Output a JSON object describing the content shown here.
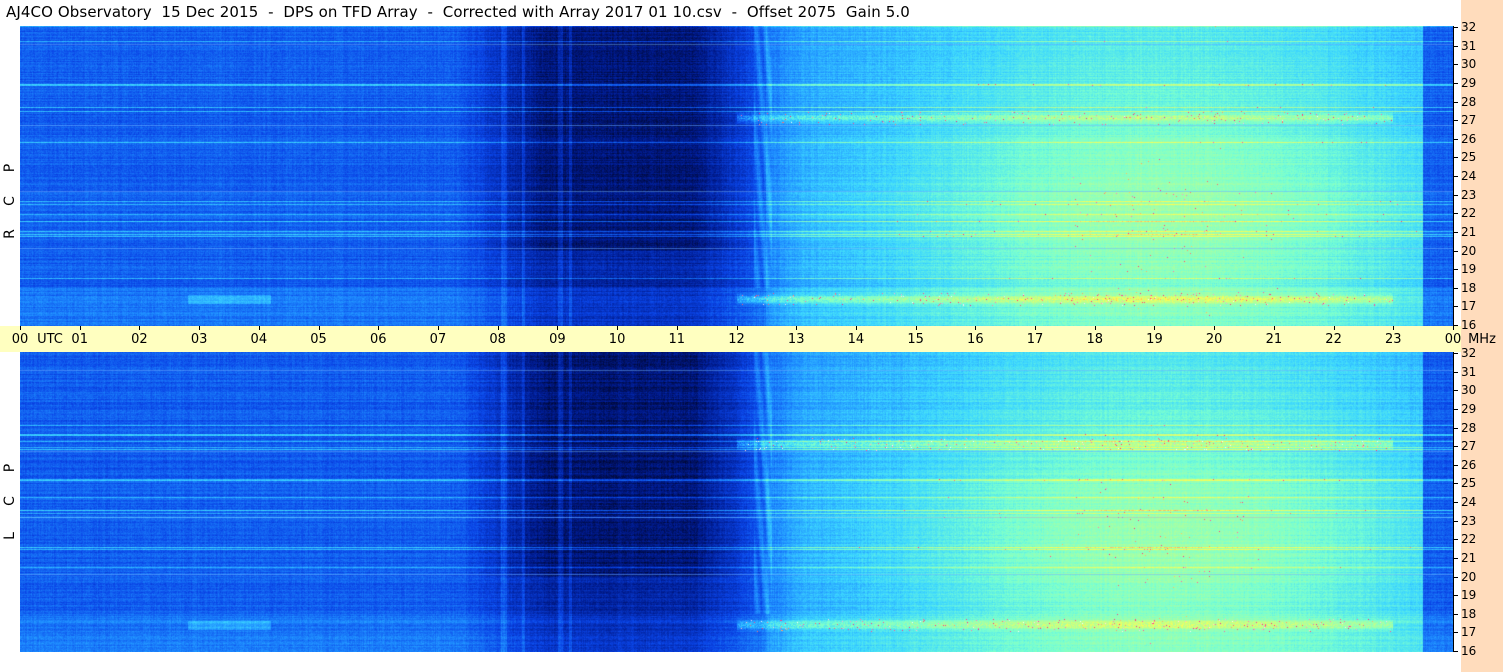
{
  "title": "AJ4CO Observatory  15 Dec 2015  -  DPS on TFD Array  -  Corrected with Array 2017 01 10.csv  -  Offset 2075  Gain 5.0",
  "panels": [
    {
      "label": [
        "R",
        "C",
        "P"
      ]
    },
    {
      "label": [
        "L",
        "C",
        "P"
      ]
    }
  ],
  "colors": {
    "background_strip": "#ffdcbc",
    "time_axis": "#ffffc0",
    "colormap": [
      "#000010",
      "#001a8c",
      "#0a44e6",
      "#1e8cff",
      "#3cd6ff",
      "#78ffd2",
      "#b4ff96",
      "#ffff50",
      "#ff2080",
      "#ffffff"
    ]
  },
  "chart_data": [
    {
      "type": "heatmap",
      "name": "RCP",
      "x_unit": "UTC",
      "y_unit": "MHz",
      "xlim": [
        0,
        24
      ],
      "ylim": [
        16,
        32
      ],
      "x_ticks": [
        "00",
        "01",
        "02",
        "03",
        "04",
        "05",
        "06",
        "07",
        "08",
        "09",
        "10",
        "11",
        "12",
        "13",
        "14",
        "15",
        "16",
        "17",
        "18",
        "19",
        "20",
        "21",
        "22",
        "23",
        "00"
      ],
      "y_ticks": [
        16,
        17,
        18,
        19,
        20,
        21,
        22,
        23,
        24,
        25,
        26,
        27,
        28,
        29,
        30,
        31,
        32
      ],
      "dark_period_hours": [
        8.3,
        12.5
      ],
      "daytime_enhancement_hours": [
        12.5,
        23.5
      ],
      "peak_hour": 19.2,
      "strong_bands_mhz": [
        17.4,
        27.1
      ]
    },
    {
      "type": "heatmap",
      "name": "LCP",
      "x_unit": "UTC",
      "y_unit": "MHz",
      "xlim": [
        0,
        24
      ],
      "ylim": [
        16,
        32
      ],
      "x_ticks": [
        "00",
        "01",
        "02",
        "03",
        "04",
        "05",
        "06",
        "07",
        "08",
        "09",
        "10",
        "11",
        "12",
        "13",
        "14",
        "15",
        "16",
        "17",
        "18",
        "19",
        "20",
        "21",
        "22",
        "23",
        "00"
      ],
      "y_ticks": [
        16,
        17,
        18,
        19,
        20,
        21,
        22,
        23,
        24,
        25,
        26,
        27,
        28,
        29,
        30,
        31,
        32
      ],
      "dark_period_hours": [
        8.3,
        12.5
      ],
      "daytime_enhancement_hours": [
        12.5,
        23.5
      ],
      "peak_hour": 19.2,
      "strong_bands_mhz": [
        17.4,
        27.1
      ]
    }
  ],
  "axis": {
    "utc_label": "UTC",
    "mhz_label": "MHz"
  }
}
